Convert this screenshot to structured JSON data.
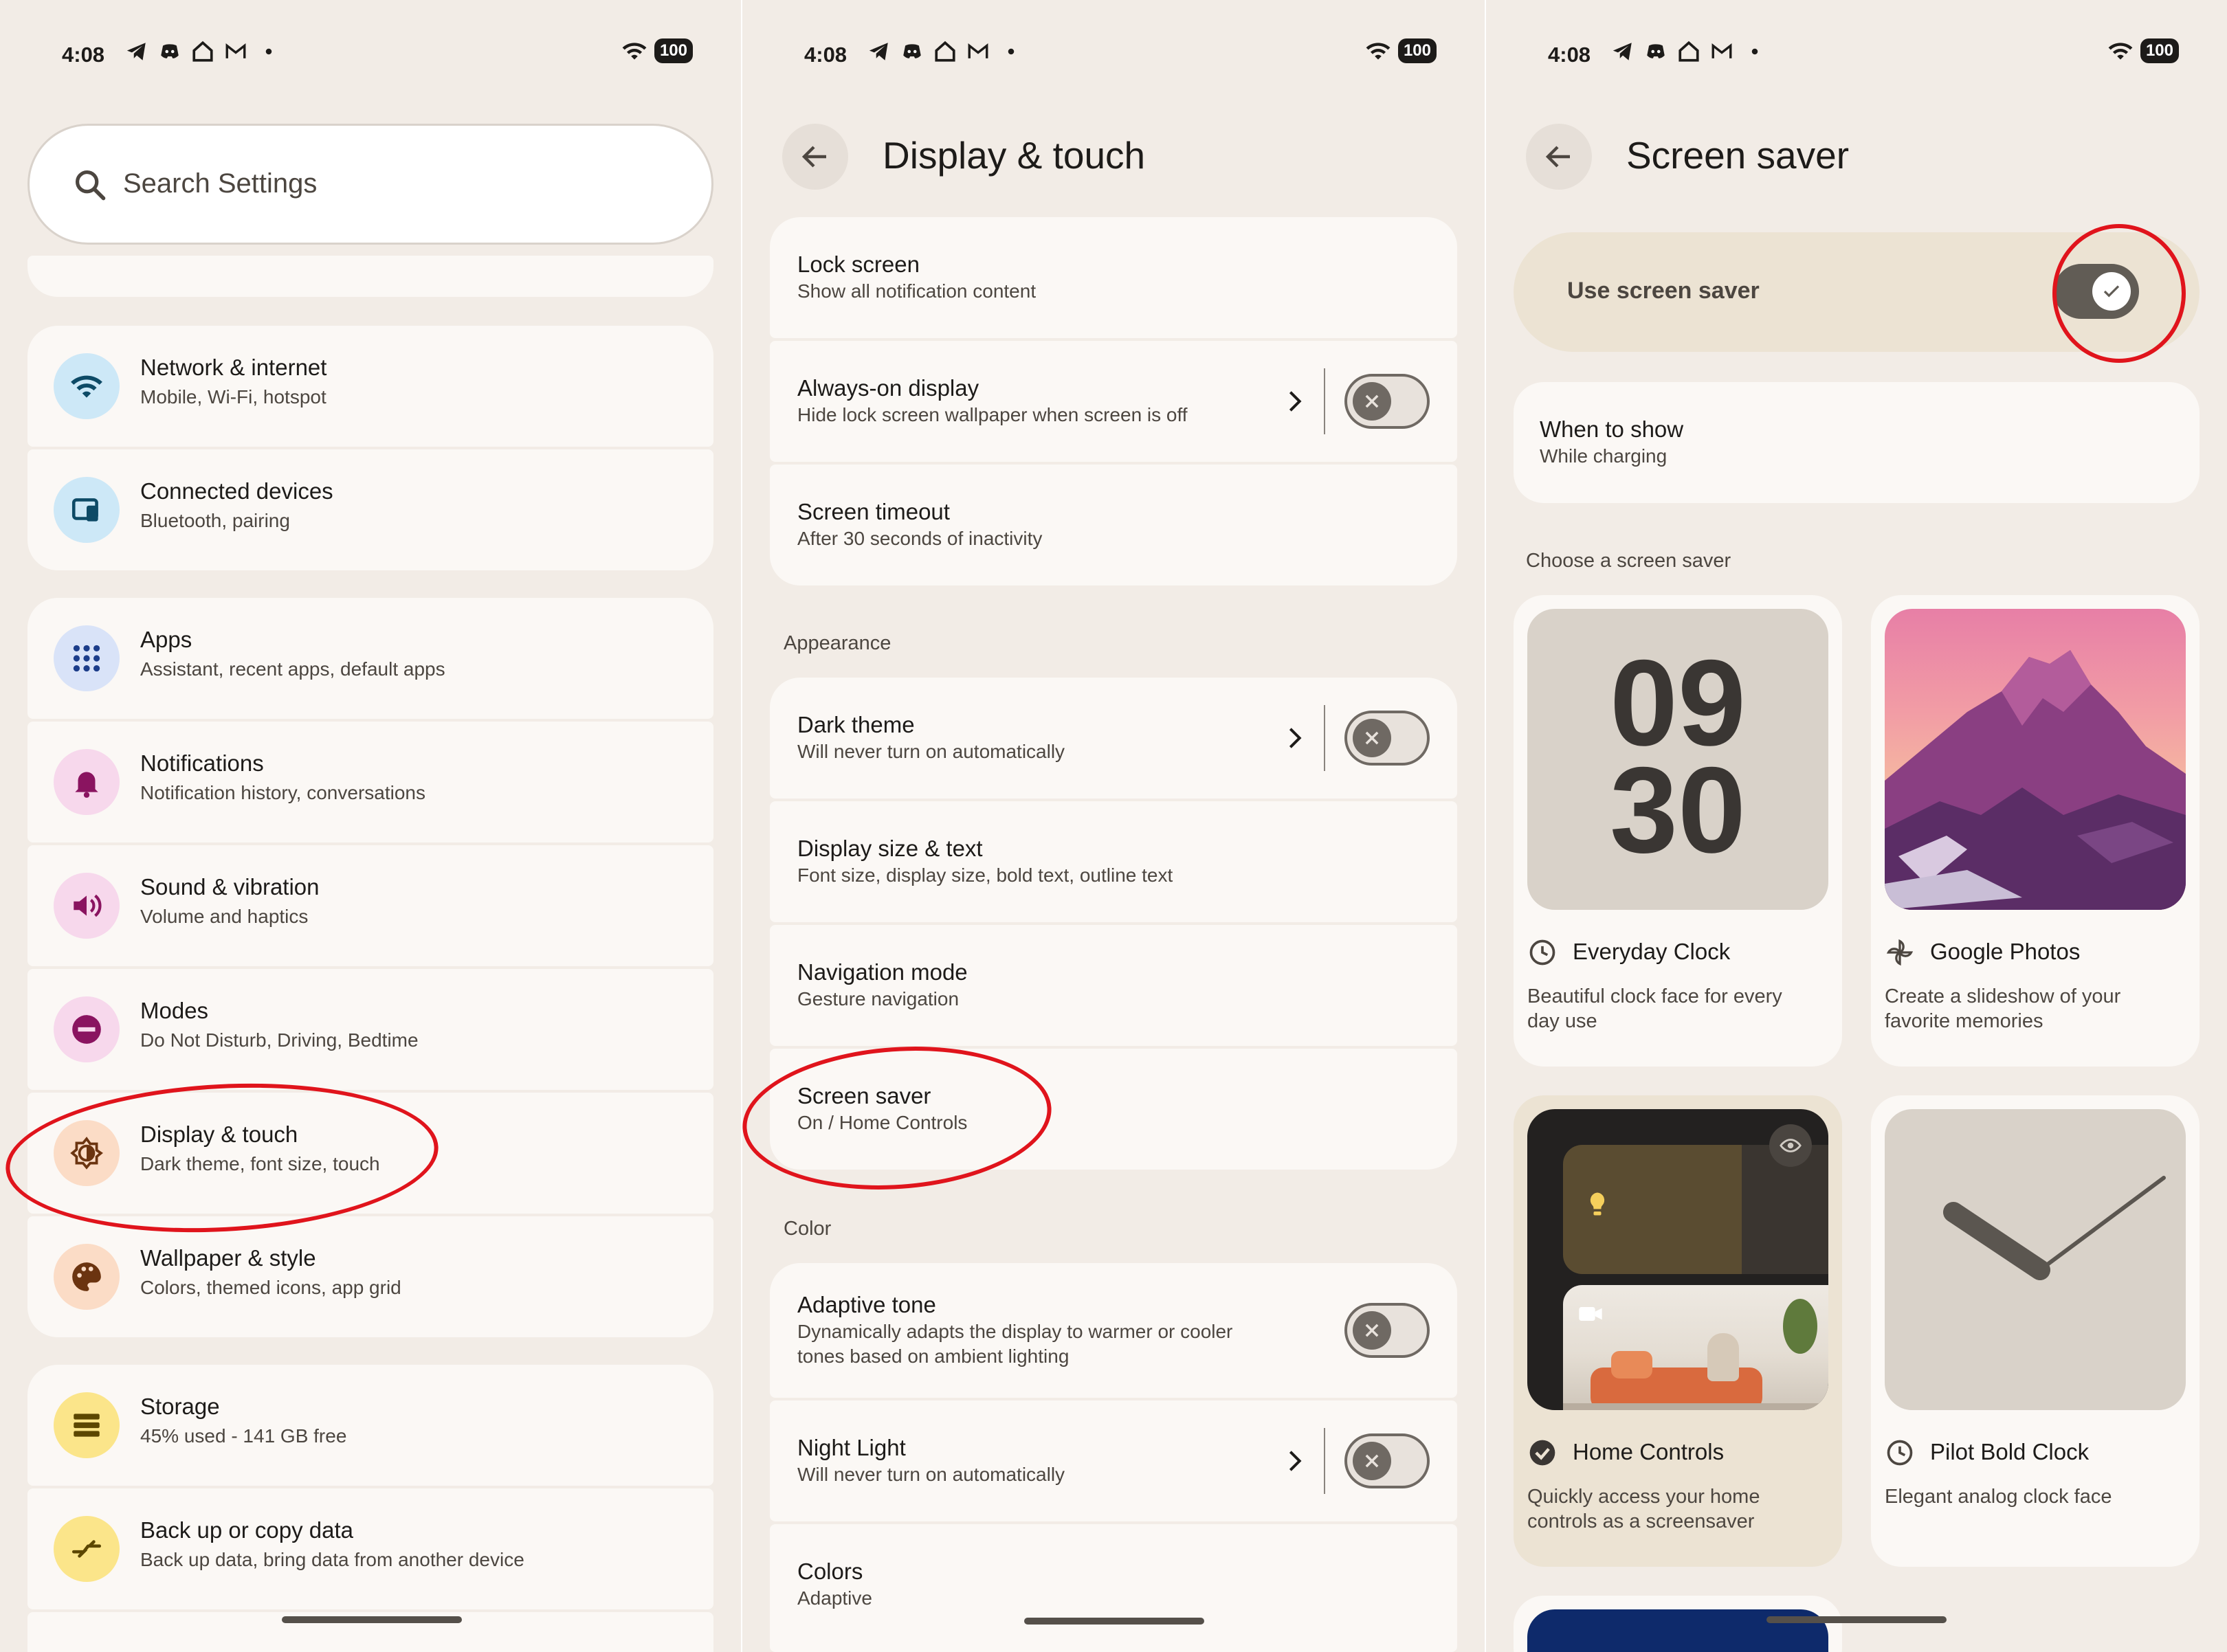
{
  "status": {
    "time": "4:08",
    "battery": "100"
  },
  "colors": {
    "accent_red": "#e0141c",
    "background": "#f2ece6",
    "card": "#fbf8f5"
  },
  "settings": {
    "search_placeholder": "Search Settings",
    "items": [
      {
        "title": "Network & internet",
        "subtitle": "Mobile, Wi-Fi, hotspot",
        "icon": "wifi-icon"
      },
      {
        "title": "Connected devices",
        "subtitle": "Bluetooth, pairing",
        "icon": "devices-icon"
      },
      {
        "title": "Apps",
        "subtitle": "Assistant, recent apps, default apps",
        "icon": "apps-grid-icon"
      },
      {
        "title": "Notifications",
        "subtitle": "Notification history, conversations",
        "icon": "bell-icon"
      },
      {
        "title": "Sound & vibration",
        "subtitle": "Volume and haptics",
        "icon": "speaker-icon"
      },
      {
        "title": "Modes",
        "subtitle": "Do Not Disturb, Driving, Bedtime",
        "icon": "dnd-icon"
      },
      {
        "title": "Display & touch",
        "subtitle": "Dark theme, font size, touch",
        "icon": "brightness-icon"
      },
      {
        "title": "Wallpaper & style",
        "subtitle": "Colors, themed icons, app grid",
        "icon": "palette-icon"
      },
      {
        "title": "Storage",
        "subtitle": "45% used - 141 GB free",
        "icon": "storage-icon"
      },
      {
        "title": "Back up or copy data",
        "subtitle": "Back up data, bring data from another device",
        "icon": "backup-icon"
      }
    ]
  },
  "display": {
    "title": "Display & touch",
    "rows_top": [
      {
        "title": "Lock screen",
        "subtitle": "Show all notification content"
      },
      {
        "title": "Always-on display",
        "subtitle": "Hide lock screen wallpaper when screen is off",
        "toggle": "off"
      },
      {
        "title": "Screen timeout",
        "subtitle": "After 30 seconds of inactivity"
      }
    ],
    "appearance_label": "Appearance",
    "rows_appearance": [
      {
        "title": "Dark theme",
        "subtitle": "Will never turn on automatically",
        "toggle": "off"
      },
      {
        "title": "Display size & text",
        "subtitle": "Font size, display size, bold text, outline text"
      },
      {
        "title": "Navigation mode",
        "subtitle": "Gesture navigation"
      },
      {
        "title": "Screen saver",
        "subtitle": "On / Home Controls"
      }
    ],
    "color_label": "Color",
    "rows_color": [
      {
        "title": "Adaptive tone",
        "subtitle_1": "Dynamically adapts the display to warmer or cooler",
        "subtitle_2": "tones based on ambient lighting",
        "toggle": "off"
      },
      {
        "title": "Night Light",
        "subtitle": "Will never turn on automatically",
        "toggle": "off"
      },
      {
        "title": "Colors",
        "subtitle": "Adaptive"
      }
    ]
  },
  "screensaver": {
    "title": "Screen saver",
    "use_label": "Use screen saver",
    "use_toggle": "on",
    "when_title": "When to show",
    "when_value": "While charging",
    "choose_label": "Choose a screen saver",
    "clock_hour": "09",
    "clock_minute": "30",
    "options": [
      {
        "title": "Everyday Clock",
        "desc_1": "Beautiful clock face for every",
        "desc_2": "day use",
        "icon": "clock-icon"
      },
      {
        "title": "Google Photos",
        "desc_1": "Create a slideshow of your",
        "desc_2": "favorite memories",
        "icon": "pinwheel-icon"
      },
      {
        "title": "Home Controls",
        "desc_1": "Quickly access your home",
        "desc_2": "controls as a screensaver",
        "icon": "check-circle-icon",
        "selected": true
      },
      {
        "title": "Pilot Bold Clock",
        "desc_1": "Elegant analog clock face",
        "desc_2": "",
        "icon": "clock-icon"
      }
    ]
  }
}
